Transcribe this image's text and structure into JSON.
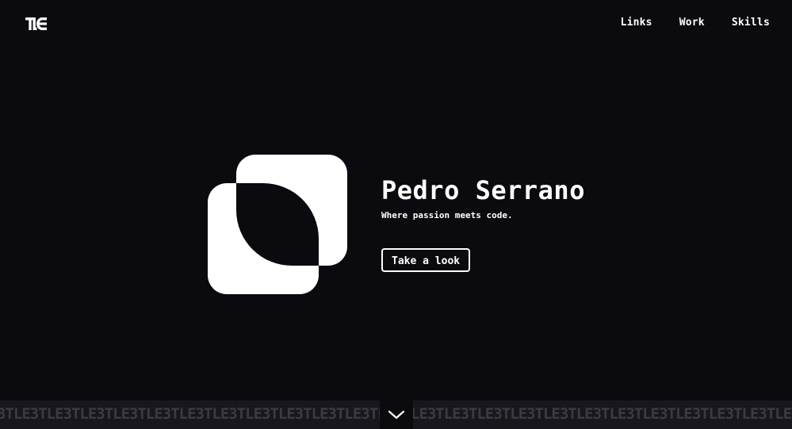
{
  "header": {
    "logo_text": "TLE",
    "nav": [
      {
        "label": "Links"
      },
      {
        "label": "Work"
      },
      {
        "label": "Skills"
      }
    ]
  },
  "hero": {
    "title": "Pedro Serrano",
    "tagline": "Where passion meets code.",
    "cta_label": "Take a look"
  },
  "footer": {
    "ticker_text": "3TLE3TLE3TLE3TLE3TLE3TLE3TLE3TLE3TLE3TLE3TLE3TLE3TLE3TLE3TLE3TLE3TLE3TLE3TLE3TLE3TLE3TLE3TLE3TLE3TLE3TLE3TLE3TLE3TLE3TLE3TLE3TLE3TLE3TLE3TLE3TLE",
    "scroll_icon": "chevron-down-icon"
  },
  "colors": {
    "background": "#0b0a0f",
    "foreground": "#ffffff",
    "band": "#18171c",
    "ticker": "#3c3b41"
  }
}
